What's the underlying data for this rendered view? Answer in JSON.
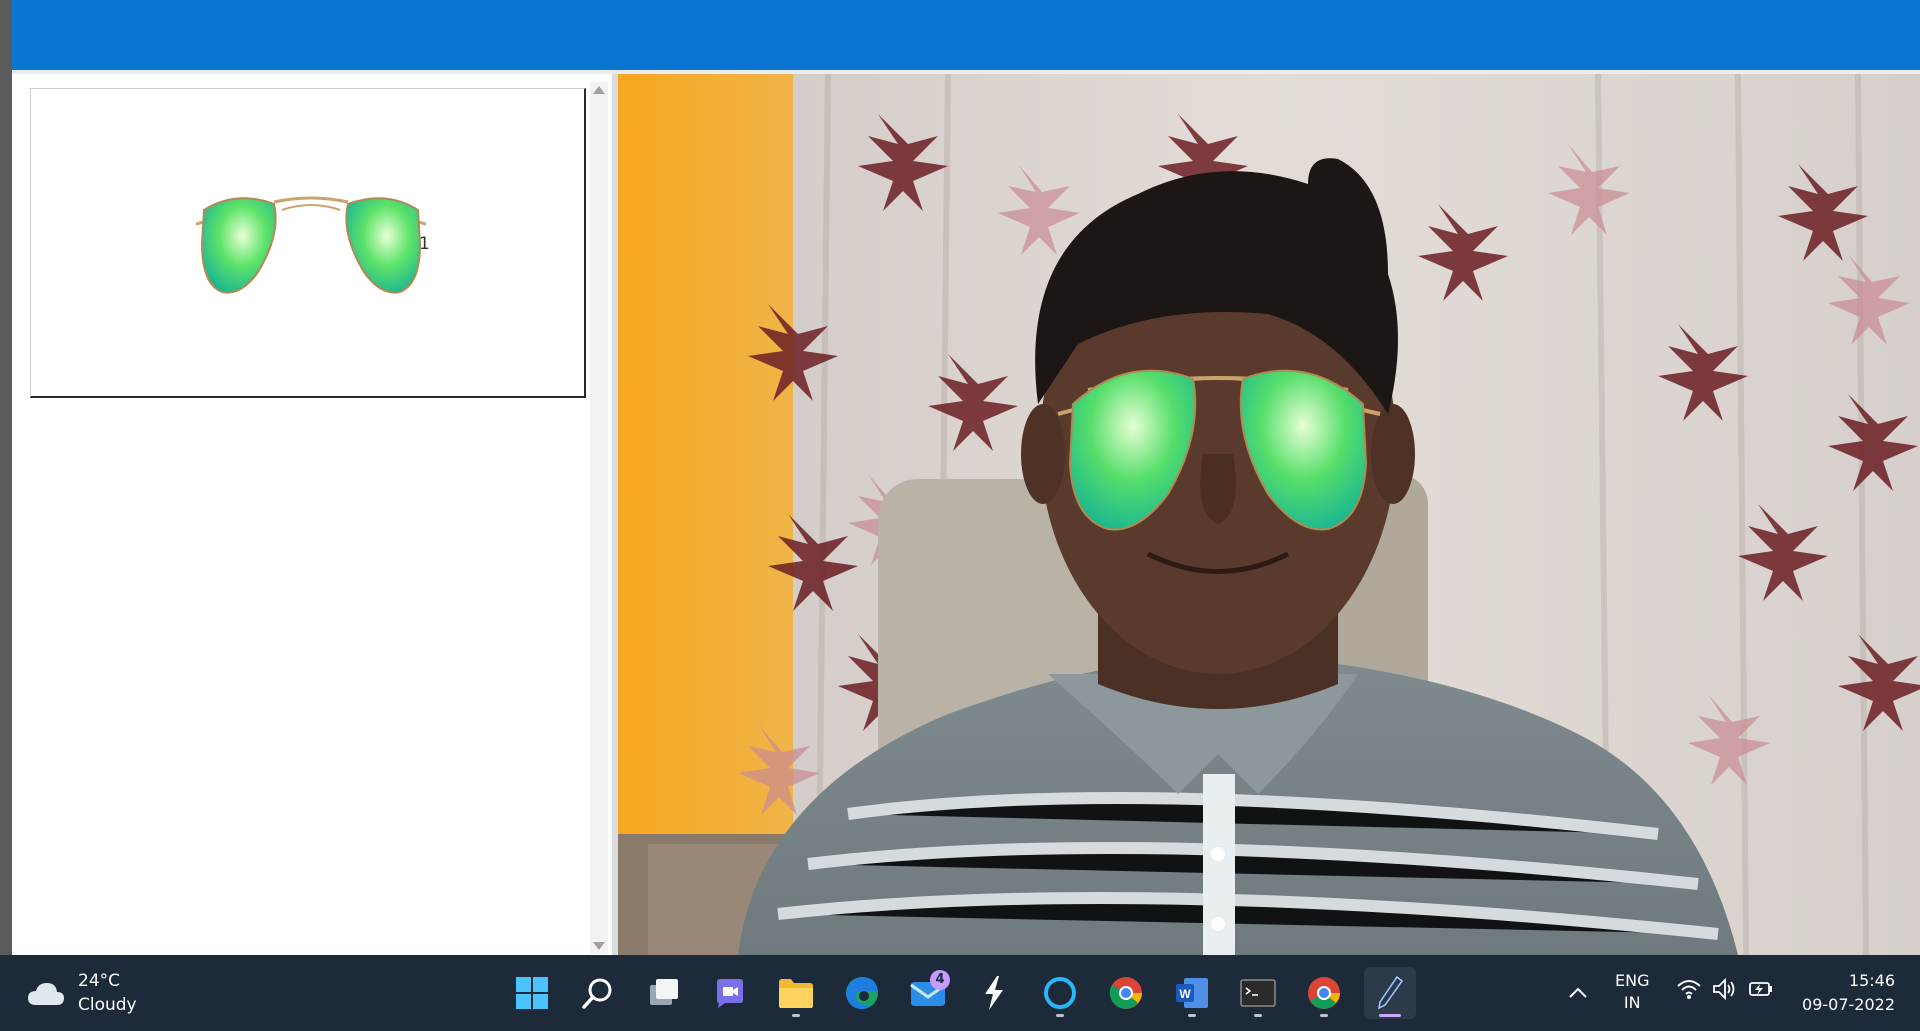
{
  "sidebar": {
    "items": [
      {
        "label": "1",
        "icon": "aviator-sunglasses-green"
      }
    ]
  },
  "camera": {
    "overlay_icon": "aviator-sunglasses-green"
  },
  "taskbar": {
    "weather": {
      "temperature": "24°C",
      "condition": "Cloudy",
      "icon": "cloud-icon"
    },
    "pinned": [
      {
        "name": "start",
        "icon": "windows-logo-icon"
      },
      {
        "name": "search",
        "icon": "search-icon"
      },
      {
        "name": "task-view",
        "icon": "task-view-icon"
      },
      {
        "name": "chat",
        "icon": "video-chat-icon"
      },
      {
        "name": "file-explorer",
        "icon": "folder-icon"
      },
      {
        "name": "edge",
        "icon": "edge-icon"
      },
      {
        "name": "mail",
        "icon": "mail-icon",
        "badge": "4"
      },
      {
        "name": "app-bolt",
        "icon": "bolt-icon"
      },
      {
        "name": "cortana",
        "icon": "ring-icon"
      },
      {
        "name": "chrome",
        "icon": "chrome-icon"
      },
      {
        "name": "word",
        "icon": "word-icon"
      },
      {
        "name": "terminal",
        "icon": "terminal-icon"
      },
      {
        "name": "chrome-2",
        "icon": "chrome-icon"
      },
      {
        "name": "pen-app",
        "icon": "pen-icon"
      }
    ],
    "language": {
      "line1": "ENG",
      "line2": "IN"
    },
    "clock": {
      "time": "15:46",
      "date": "09-07-2022"
    }
  },
  "colors": {
    "titlebar": "#0a74d0",
    "taskbar": "#1c2a3a",
    "lens_green": "#22c98a",
    "wall_orange": "#f5a623"
  }
}
